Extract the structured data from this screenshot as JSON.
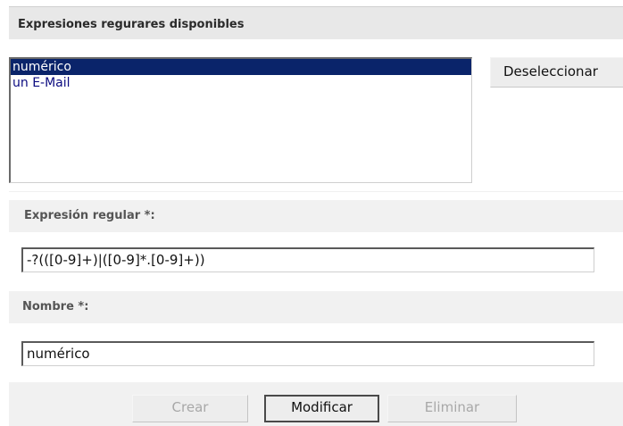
{
  "header": {
    "title": "Expresiones regurares disponibles"
  },
  "list": {
    "items": [
      {
        "label": "numérico",
        "selected": true
      },
      {
        "label": "un E-Mail",
        "selected": false
      }
    ]
  },
  "deselect_button": {
    "label": "Deseleccionar"
  },
  "regex_field": {
    "label": "Expresión regular *:",
    "value": "-?(([0-9]+)|([0-9]*.[0-9]+))"
  },
  "name_field": {
    "label": "Nombre *:",
    "value": "numérico"
  },
  "actions": {
    "create": {
      "label": "Crear",
      "enabled": false
    },
    "modify": {
      "label": "Modificar",
      "enabled": true
    },
    "delete": {
      "label": "Eliminar",
      "enabled": false
    }
  },
  "colors": {
    "selection": "#0a246a",
    "list_text": "#0b0b80",
    "header_bg": "#e8e8e8",
    "label_bg": "#f1f1f1"
  }
}
